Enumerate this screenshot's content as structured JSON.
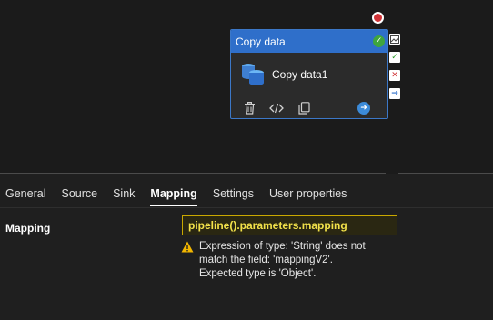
{
  "activity": {
    "type_label": "Copy data",
    "name": "Copy data1",
    "status_icon": "check-circle-icon",
    "tools": [
      "delete-icon",
      "code-icon",
      "copy-icon"
    ],
    "navigate_icon": "arrow-right-circle-icon"
  },
  "side_outputs": [
    "image-icon",
    "success-check-icon",
    "failure-x-icon",
    "completion-arrow-icon"
  ],
  "tabs": [
    {
      "label": "General"
    },
    {
      "label": "Source"
    },
    {
      "label": "Sink"
    },
    {
      "label": "Mapping",
      "active": true
    },
    {
      "label": "Settings"
    },
    {
      "label": "User properties"
    }
  ],
  "mapping": {
    "label": "Mapping",
    "value": "pipeline().parameters.mapping",
    "error_lines": [
      "Expression of type: 'String' does not",
      "match the field: 'mappingV2'.",
      "Expected type is 'Object'."
    ]
  },
  "colors": {
    "accent": "#2f6fca",
    "success": "#3fa53f",
    "error": "#d13438",
    "warning": "#f2b600",
    "expression": "#f2e14a"
  }
}
